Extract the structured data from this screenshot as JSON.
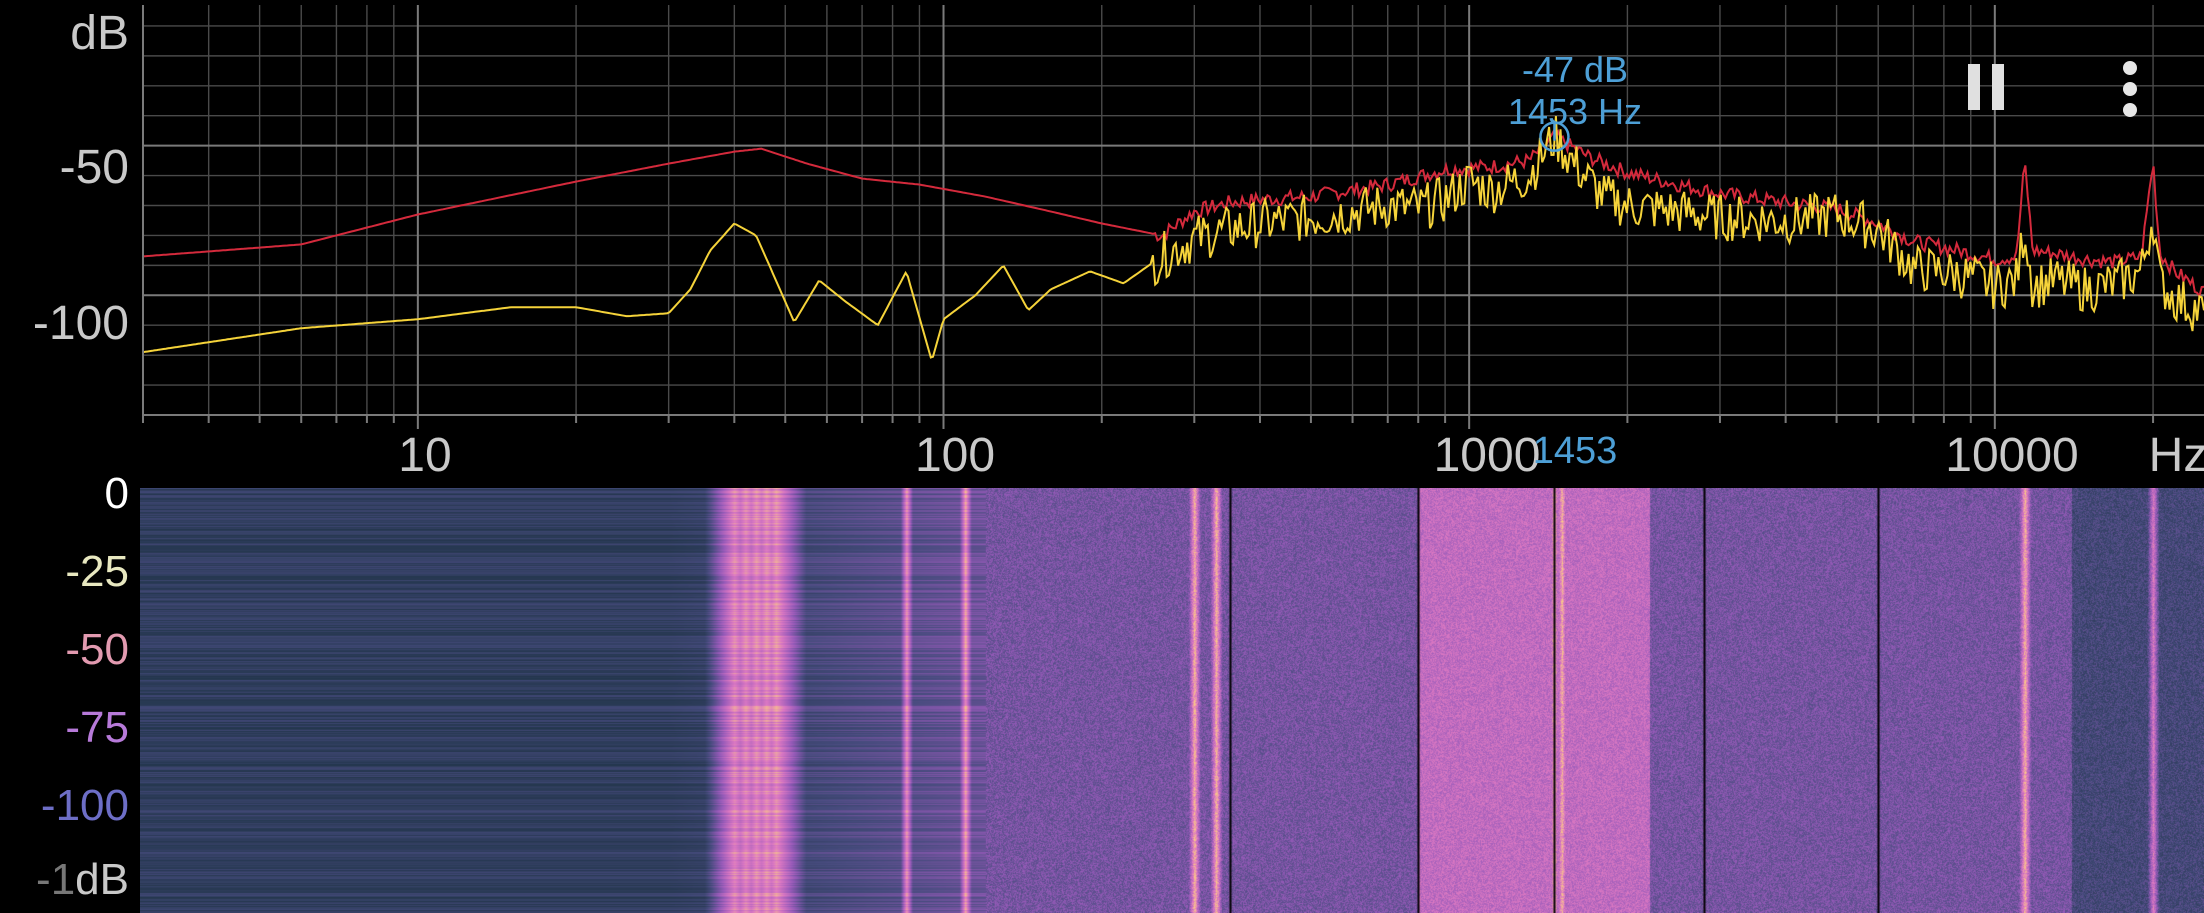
{
  "spectrum": {
    "y_unit": "dB",
    "y_ticks": [
      {
        "label": "-50",
        "value": -50
      },
      {
        "label": "-100",
        "value": -100
      }
    ],
    "x_unit": "Hz",
    "x_ticks": [
      {
        "label": "10",
        "value": 10
      },
      {
        "label": "100",
        "value": 100
      },
      {
        "label": "1000",
        "value": 1000
      },
      {
        "label": "10000",
        "value": 10000
      }
    ],
    "x_range_hz": [
      3,
      25000
    ],
    "y_range_db": [
      -140,
      -3
    ],
    "peak": {
      "db_label": "-47 dB",
      "hz_label": "1453 Hz",
      "marker_label": "1453",
      "hz": 1453,
      "db": -47
    },
    "series": {
      "max_color": "#d42a3c",
      "live_color": "#f5d33a",
      "max_anchors": [
        [
          3,
          -87
        ],
        [
          6,
          -83
        ],
        [
          10,
          -73
        ],
        [
          20,
          -62
        ],
        [
          30,
          -56
        ],
        [
          40,
          -52
        ],
        [
          45,
          -51
        ],
        [
          55,
          -56
        ],
        [
          70,
          -61
        ],
        [
          90,
          -63
        ],
        [
          120,
          -67
        ],
        [
          160,
          -72
        ],
        [
          200,
          -76
        ],
        [
          260,
          -80
        ],
        [
          300,
          -72
        ],
        [
          350,
          -69
        ],
        [
          400,
          -68
        ],
        [
          500,
          -67
        ],
        [
          700,
          -63
        ],
        [
          900,
          -58
        ],
        [
          1100,
          -57
        ],
        [
          1300,
          -55
        ],
        [
          1453,
          -47
        ],
        [
          1700,
          -54
        ],
        [
          2000,
          -59
        ],
        [
          2500,
          -63
        ],
        [
          3000,
          -66
        ],
        [
          4000,
          -69
        ],
        [
          5000,
          -71
        ],
        [
          6000,
          -76
        ],
        [
          7000,
          -82
        ],
        [
          8000,
          -84
        ],
        [
          9000,
          -86
        ],
        [
          10000,
          -88
        ],
        [
          11000,
          -87
        ],
        [
          11400,
          -55
        ],
        [
          11800,
          -85
        ],
        [
          13000,
          -86
        ],
        [
          15000,
          -88
        ],
        [
          17000,
          -89
        ],
        [
          19000,
          -87
        ],
        [
          20000,
          -55
        ],
        [
          20600,
          -86
        ],
        [
          22000,
          -92
        ],
        [
          25000,
          -99
        ]
      ],
      "live_anchors": [
        [
          3,
          -119
        ],
        [
          6,
          -111
        ],
        [
          10,
          -108
        ],
        [
          15,
          -104
        ],
        [
          20,
          -104
        ],
        [
          25,
          -107
        ],
        [
          30,
          -106
        ],
        [
          33,
          -98
        ],
        [
          36,
          -85
        ],
        [
          40,
          -76
        ],
        [
          44,
          -80
        ],
        [
          48,
          -95
        ],
        [
          52,
          -109
        ],
        [
          58,
          -95
        ],
        [
          65,
          -102
        ],
        [
          75,
          -110
        ],
        [
          85,
          -92
        ],
        [
          95,
          -122
        ],
        [
          100,
          -108
        ],
        [
          115,
          -100
        ],
        [
          130,
          -90
        ],
        [
          145,
          -105
        ],
        [
          160,
          -98
        ],
        [
          190,
          -92
        ],
        [
          220,
          -96
        ],
        [
          260,
          -87
        ],
        [
          300,
          -81
        ],
        [
          350,
          -78
        ],
        [
          400,
          -76
        ],
        [
          500,
          -74
        ],
        [
          600,
          -72
        ],
        [
          700,
          -70
        ],
        [
          800,
          -71
        ],
        [
          900,
          -68
        ],
        [
          1000,
          -62
        ],
        [
          1100,
          -65
        ],
        [
          1300,
          -60
        ],
        [
          1453,
          -47
        ],
        [
          1600,
          -57
        ],
        [
          1800,
          -67
        ],
        [
          2000,
          -70
        ],
        [
          2500,
          -72
        ],
        [
          3000,
          -74
        ],
        [
          4000,
          -75
        ],
        [
          5000,
          -73
        ],
        [
          6000,
          -78
        ],
        [
          7000,
          -91
        ],
        [
          8000,
          -92
        ],
        [
          9000,
          -94
        ],
        [
          10000,
          -97
        ],
        [
          11000,
          -95
        ],
        [
          11400,
          -77
        ],
        [
          11800,
          -97
        ],
        [
          13000,
          -95
        ],
        [
          15000,
          -98
        ],
        [
          17000,
          -96
        ],
        [
          19000,
          -92
        ],
        [
          20000,
          -73
        ],
        [
          20600,
          -96
        ],
        [
          22000,
          -101
        ],
        [
          25000,
          -106
        ]
      ]
    }
  },
  "spectrogram": {
    "color_scale_ticks": [
      {
        "label": "0",
        "color": "#ffffff"
      },
      {
        "label": "-25",
        "color": "#e8e8c0"
      },
      {
        "label": "-50",
        "color": "#e29ab0"
      },
      {
        "label": "-75",
        "color": "#b77ad9"
      },
      {
        "label": "-100",
        "color": "#6d6ec6"
      },
      {
        "label": "-1",
        "color": "#c9c9c9"
      }
    ],
    "unit": "dB",
    "band_lines_hz": [
      350,
      800,
      1453,
      2800,
      6000
    ],
    "bright_lines_hz": [
      40,
      42,
      44,
      46,
      48,
      85,
      110,
      300,
      330,
      1450,
      1500,
      11400,
      20000
    ]
  },
  "toolbar": {
    "pause_icon": "pause-icon",
    "menu_icon": "more-vertical-icon"
  },
  "colors": {
    "grid": "#4a4a4a",
    "grid_major": "#7a7a7a",
    "peak": "#4d9fd6"
  }
}
